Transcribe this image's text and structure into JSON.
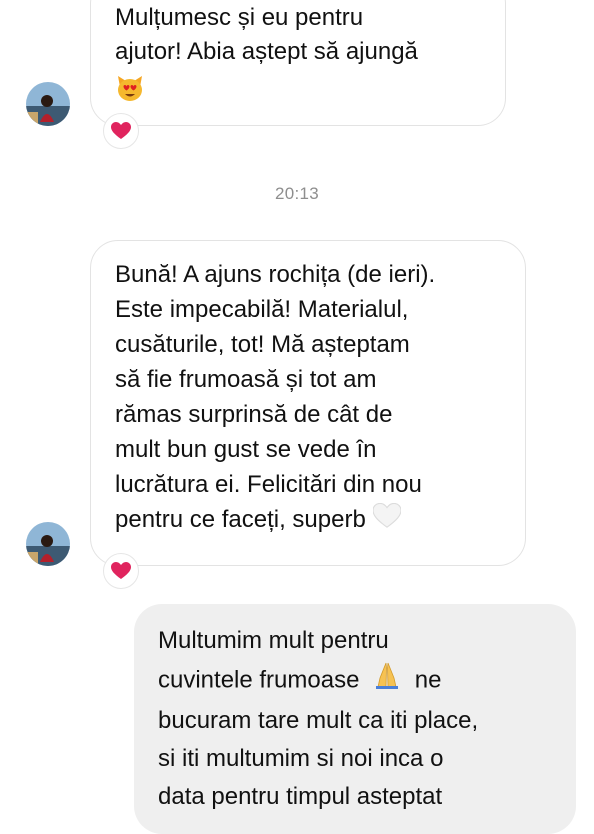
{
  "conversation": {
    "messages": [
      {
        "direction": "incoming",
        "lines": [
          "Mulțumesc și eu pentru",
          "ajutor! Abia aștept să ajungă"
        ],
        "trailing_emoji": "smiling-cat-heart-eyes",
        "reaction": "red-heart"
      },
      {
        "direction": "incoming",
        "lines": [
          "Bună! A ajuns rochița (de ieri).",
          "Este impecabilă! Materialul,",
          "cusăturile, tot! Mă așteptam",
          "să fie frumoasă și tot am",
          "rămas surprinsă de cât de",
          "mult bun gust se vede în",
          "lucrătura ei. Felicitări din nou",
          "pentru ce faceți, superb"
        ],
        "trailing_emoji": "white-heart",
        "reaction": "red-heart"
      },
      {
        "direction": "outgoing",
        "lines": [
          "Multumim mult pentru",
          "cuvintele frumoase",
          "ne",
          "bucuram tare mult ca iti place,",
          "si iti multumim si noi inca o",
          "data pentru timpul asteptat"
        ],
        "inline_emoji": "folded-hands"
      }
    ],
    "timestamp": "20:13"
  },
  "colors": {
    "incoming_bubble_border": "#e3e3e3",
    "outgoing_bubble_bg": "#efefef",
    "timestamp_text": "#8e8e8e",
    "reaction_heart": "#e0245e"
  }
}
